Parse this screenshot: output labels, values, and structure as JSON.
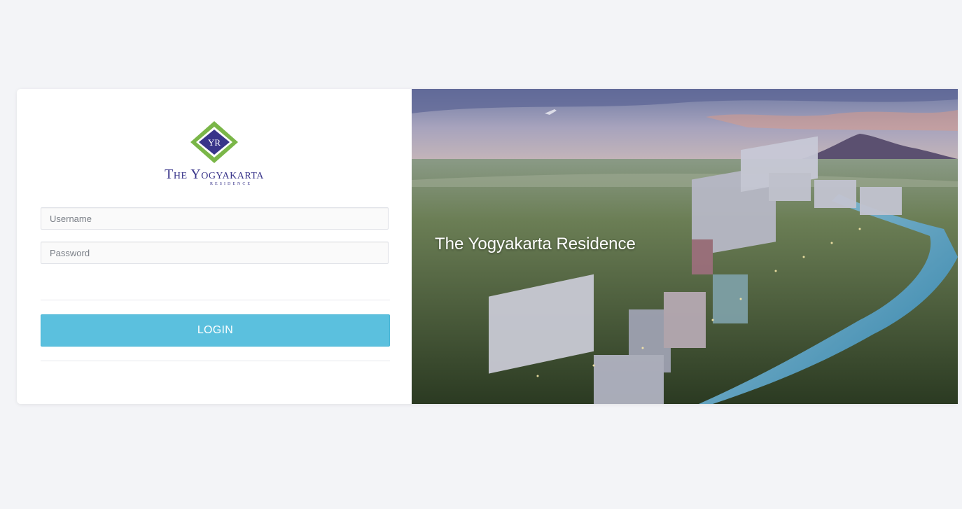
{
  "brand": {
    "logo_monogram": "YR",
    "logo_title": "The Yogyakarta",
    "logo_subtitle": "RESIDENCE",
    "primary_color": "#38348a",
    "accent_color": "#7ab648"
  },
  "login_form": {
    "username_placeholder": "Username",
    "username_value": "",
    "password_placeholder": "Password",
    "password_value": "",
    "login_label": "LOGIN",
    "login_color": "#5bc0de"
  },
  "hero": {
    "title": "The Yogyakarta Residence",
    "image_icon": "aerial-city-illustration"
  }
}
